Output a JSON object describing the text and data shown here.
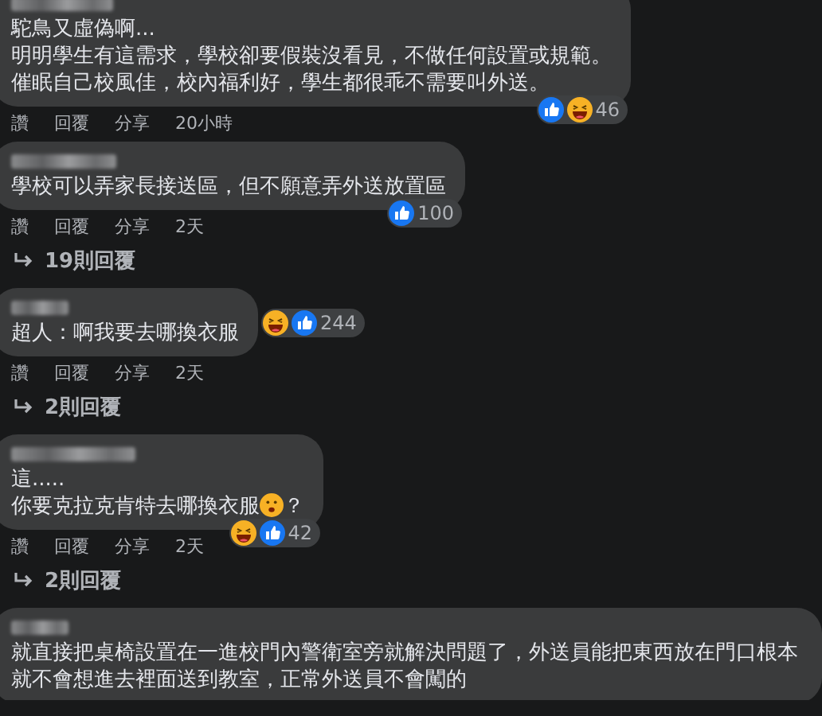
{
  "comments": [
    {
      "lines": [
        [
          {
            "kind": "text",
            "text": "駝鳥又虛偽啊..."
          }
        ],
        [
          {
            "kind": "text",
            "text": "明明學生有這需求，學校卻要假裝沒看見，不做任何設置或規範。"
          }
        ],
        [
          {
            "kind": "text",
            "text": "催眠自己校風佳，校內福利好，學生都很乖不需要叫外送。"
          }
        ]
      ],
      "reactions": [
        {
          "kind": "like"
        },
        {
          "kind": "haha"
        }
      ],
      "count": "46",
      "reactions_beside": false,
      "actions": [
        "讚",
        "回覆",
        "分享"
      ],
      "time": "20小時"
    },
    {
      "lines": [
        [
          {
            "kind": "text",
            "text": "學校可以弄家長接送區，但不願意弄外送放置區"
          }
        ]
      ],
      "reactions": [
        {
          "kind": "like"
        }
      ],
      "count": "100",
      "reactions_beside": false,
      "actions": [
        "讚",
        "回覆",
        "分享"
      ],
      "time": "2天",
      "replies": "19則回覆"
    },
    {
      "lines": [
        [
          {
            "kind": "text",
            "text": "超人：啊我要去哪換衣服"
          }
        ]
      ],
      "reactions": [
        {
          "kind": "haha"
        },
        {
          "kind": "like"
        }
      ],
      "count": "244",
      "reactions_beside": true,
      "actions": [
        "讚",
        "回覆",
        "分享"
      ],
      "time": "2天",
      "replies": "2則回覆"
    },
    {
      "lines": [
        [
          {
            "kind": "text",
            "text": "這....."
          }
        ],
        [
          {
            "kind": "text",
            "text": "你要克拉克肯特去哪換衣服"
          },
          {
            "kind": "emoji"
          },
          {
            "kind": "text",
            "text": "？"
          }
        ]
      ],
      "reactions": [
        {
          "kind": "haha"
        },
        {
          "kind": "like"
        }
      ],
      "count": "42",
      "reactions_beside": false,
      "actions": [
        "讚",
        "回覆",
        "分享"
      ],
      "time": "2天",
      "replies": "2則回覆"
    },
    {
      "lines": [
        [
          {
            "kind": "text",
            "text": "就直接把桌椅設置在一進校門內警衛室旁就解決問題了，外送員能把東西放在門口根本就不會想進去裡面送到教室，正常外送員不會闖的"
          }
        ]
      ]
    }
  ]
}
